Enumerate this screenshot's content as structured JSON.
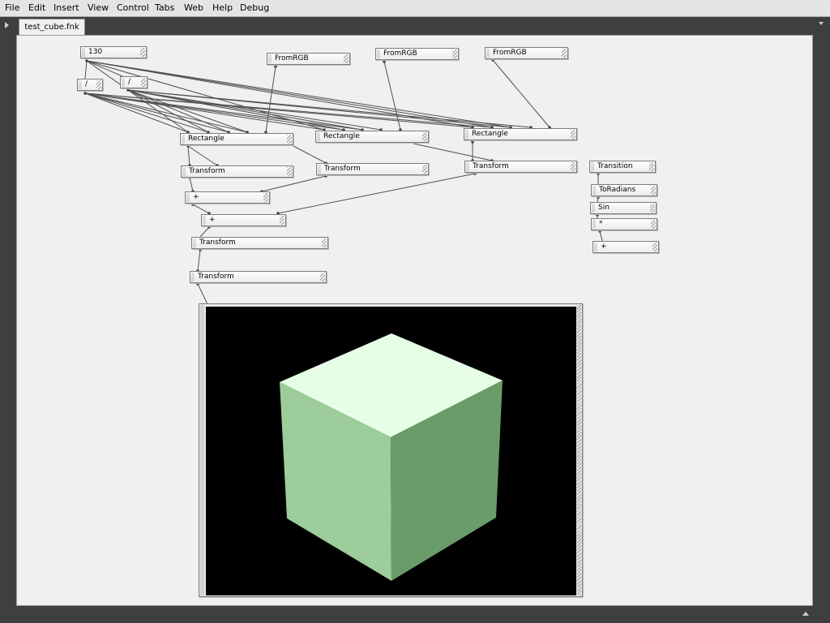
{
  "menu": {
    "items": [
      "File",
      "Edit",
      "Insert",
      "View",
      "Control",
      "Tabs",
      "Web",
      "Help",
      "Debug"
    ]
  },
  "tabs": [
    {
      "label": "test_cube.fnk",
      "active": true
    }
  ],
  "graph": {
    "nodes": [
      {
        "id": "n130",
        "label": "130"
      },
      {
        "id": "div1",
        "label": "/"
      },
      {
        "id": "div2",
        "label": "/"
      },
      {
        "id": "rgb1",
        "label": "FromRGB"
      },
      {
        "id": "rgb2",
        "label": "FromRGB"
      },
      {
        "id": "rgb3",
        "label": "FromRGB"
      },
      {
        "id": "rect1",
        "label": "Rectangle"
      },
      {
        "id": "rect2",
        "label": "Rectangle"
      },
      {
        "id": "rect3",
        "label": "Rectangle"
      },
      {
        "id": "tr1",
        "label": "Transform"
      },
      {
        "id": "tr2",
        "label": "Transform"
      },
      {
        "id": "tr3",
        "label": "Transform"
      },
      {
        "id": "plus1",
        "label": "+"
      },
      {
        "id": "plus2",
        "label": "+"
      },
      {
        "id": "tr4",
        "label": "Transform"
      },
      {
        "id": "tr5",
        "label": "Transform"
      },
      {
        "id": "trans",
        "label": "Transition"
      },
      {
        "id": "torad",
        "label": "ToRadians"
      },
      {
        "id": "sin",
        "label": "Sin"
      },
      {
        "id": "mul",
        "label": "*"
      },
      {
        "id": "plus3",
        "label": "+"
      }
    ]
  },
  "viewport": {
    "background": "#000000",
    "cube_colors": {
      "top": "#e6fde6",
      "left": "#9ccd9a",
      "right": "#699c69"
    }
  }
}
